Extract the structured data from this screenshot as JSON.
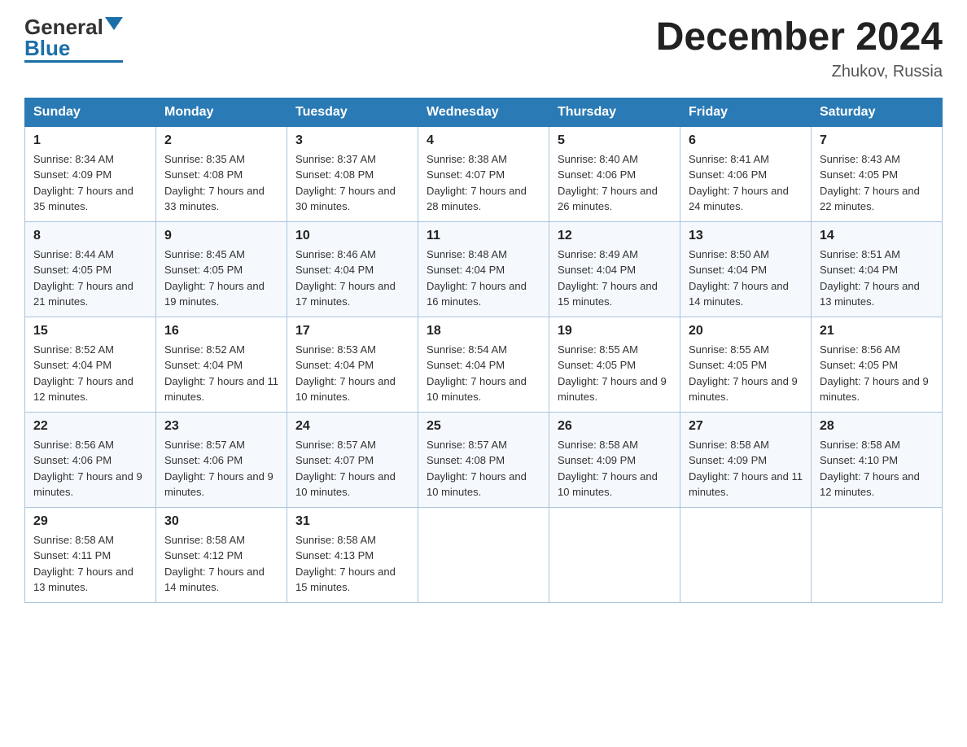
{
  "header": {
    "logo": {
      "general": "General",
      "blue": "Blue"
    },
    "title": "December 2024",
    "location": "Zhukov, Russia"
  },
  "weekdays": [
    "Sunday",
    "Monday",
    "Tuesday",
    "Wednesday",
    "Thursday",
    "Friday",
    "Saturday"
  ],
  "weeks": [
    [
      {
        "day": "1",
        "sunrise": "8:34 AM",
        "sunset": "4:09 PM",
        "daylight": "7 hours and 35 minutes."
      },
      {
        "day": "2",
        "sunrise": "8:35 AM",
        "sunset": "4:08 PM",
        "daylight": "7 hours and 33 minutes."
      },
      {
        "day": "3",
        "sunrise": "8:37 AM",
        "sunset": "4:08 PM",
        "daylight": "7 hours and 30 minutes."
      },
      {
        "day": "4",
        "sunrise": "8:38 AM",
        "sunset": "4:07 PM",
        "daylight": "7 hours and 28 minutes."
      },
      {
        "day": "5",
        "sunrise": "8:40 AM",
        "sunset": "4:06 PM",
        "daylight": "7 hours and 26 minutes."
      },
      {
        "day": "6",
        "sunrise": "8:41 AM",
        "sunset": "4:06 PM",
        "daylight": "7 hours and 24 minutes."
      },
      {
        "day": "7",
        "sunrise": "8:43 AM",
        "sunset": "4:05 PM",
        "daylight": "7 hours and 22 minutes."
      }
    ],
    [
      {
        "day": "8",
        "sunrise": "8:44 AM",
        "sunset": "4:05 PM",
        "daylight": "7 hours and 21 minutes."
      },
      {
        "day": "9",
        "sunrise": "8:45 AM",
        "sunset": "4:05 PM",
        "daylight": "7 hours and 19 minutes."
      },
      {
        "day": "10",
        "sunrise": "8:46 AM",
        "sunset": "4:04 PM",
        "daylight": "7 hours and 17 minutes."
      },
      {
        "day": "11",
        "sunrise": "8:48 AM",
        "sunset": "4:04 PM",
        "daylight": "7 hours and 16 minutes."
      },
      {
        "day": "12",
        "sunrise": "8:49 AM",
        "sunset": "4:04 PM",
        "daylight": "7 hours and 15 minutes."
      },
      {
        "day": "13",
        "sunrise": "8:50 AM",
        "sunset": "4:04 PM",
        "daylight": "7 hours and 14 minutes."
      },
      {
        "day": "14",
        "sunrise": "8:51 AM",
        "sunset": "4:04 PM",
        "daylight": "7 hours and 13 minutes."
      }
    ],
    [
      {
        "day": "15",
        "sunrise": "8:52 AM",
        "sunset": "4:04 PM",
        "daylight": "7 hours and 12 minutes."
      },
      {
        "day": "16",
        "sunrise": "8:52 AM",
        "sunset": "4:04 PM",
        "daylight": "7 hours and 11 minutes."
      },
      {
        "day": "17",
        "sunrise": "8:53 AM",
        "sunset": "4:04 PM",
        "daylight": "7 hours and 10 minutes."
      },
      {
        "day": "18",
        "sunrise": "8:54 AM",
        "sunset": "4:04 PM",
        "daylight": "7 hours and 10 minutes."
      },
      {
        "day": "19",
        "sunrise": "8:55 AM",
        "sunset": "4:05 PM",
        "daylight": "7 hours and 9 minutes."
      },
      {
        "day": "20",
        "sunrise": "8:55 AM",
        "sunset": "4:05 PM",
        "daylight": "7 hours and 9 minutes."
      },
      {
        "day": "21",
        "sunrise": "8:56 AM",
        "sunset": "4:05 PM",
        "daylight": "7 hours and 9 minutes."
      }
    ],
    [
      {
        "day": "22",
        "sunrise": "8:56 AM",
        "sunset": "4:06 PM",
        "daylight": "7 hours and 9 minutes."
      },
      {
        "day": "23",
        "sunrise": "8:57 AM",
        "sunset": "4:06 PM",
        "daylight": "7 hours and 9 minutes."
      },
      {
        "day": "24",
        "sunrise": "8:57 AM",
        "sunset": "4:07 PM",
        "daylight": "7 hours and 10 minutes."
      },
      {
        "day": "25",
        "sunrise": "8:57 AM",
        "sunset": "4:08 PM",
        "daylight": "7 hours and 10 minutes."
      },
      {
        "day": "26",
        "sunrise": "8:58 AM",
        "sunset": "4:09 PM",
        "daylight": "7 hours and 10 minutes."
      },
      {
        "day": "27",
        "sunrise": "8:58 AM",
        "sunset": "4:09 PM",
        "daylight": "7 hours and 11 minutes."
      },
      {
        "day": "28",
        "sunrise": "8:58 AM",
        "sunset": "4:10 PM",
        "daylight": "7 hours and 12 minutes."
      }
    ],
    [
      {
        "day": "29",
        "sunrise": "8:58 AM",
        "sunset": "4:11 PM",
        "daylight": "7 hours and 13 minutes."
      },
      {
        "day": "30",
        "sunrise": "8:58 AM",
        "sunset": "4:12 PM",
        "daylight": "7 hours and 14 minutes."
      },
      {
        "day": "31",
        "sunrise": "8:58 AM",
        "sunset": "4:13 PM",
        "daylight": "7 hours and 15 minutes."
      },
      null,
      null,
      null,
      null
    ]
  ]
}
